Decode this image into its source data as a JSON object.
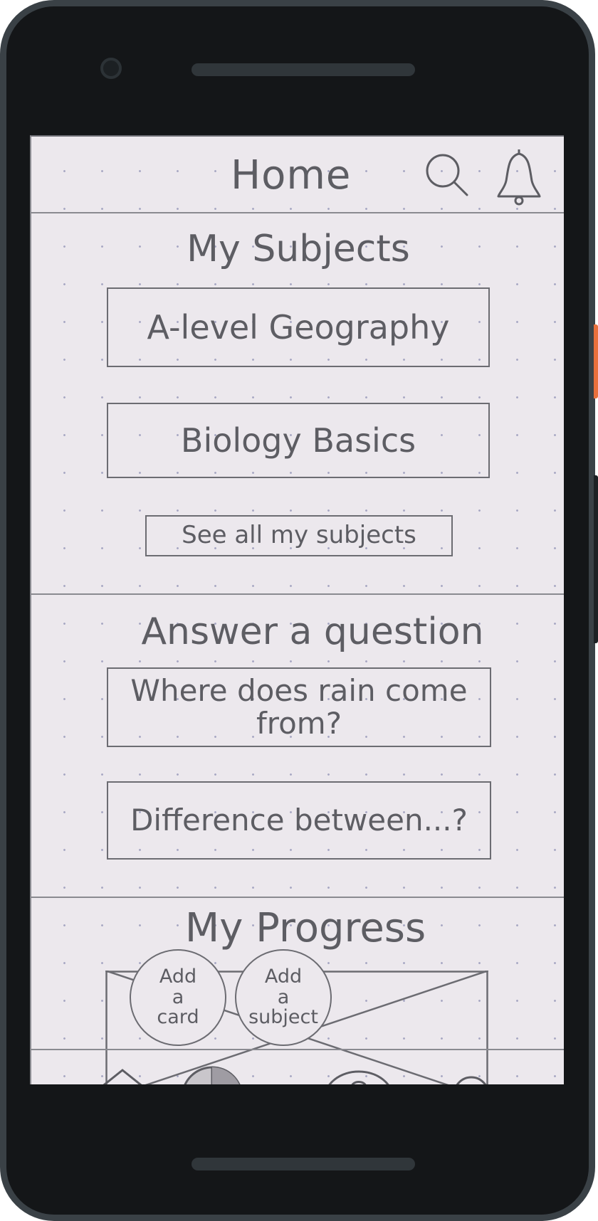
{
  "header": {
    "title": "Home",
    "search_icon": "search-icon",
    "notification_icon": "bell-icon"
  },
  "my_subjects": {
    "title": "My Subjects",
    "items": [
      {
        "label": "A-level Geography"
      },
      {
        "label": "Biology Basics"
      }
    ],
    "see_all_label": "See all my subjects"
  },
  "answer_question": {
    "title": "Answer a question",
    "items": [
      {
        "label": "Where does rain come from?"
      },
      {
        "label": "Difference between...?"
      }
    ]
  },
  "my_progress": {
    "title": "My Progress",
    "add_card_label": "Add\na\ncard",
    "add_subject_label": "Add\na\nsubject",
    "chart_placeholder": "image-placeholder"
  },
  "bottom_nav": {
    "items": [
      "home-icon",
      "pie-chart-icon",
      "question-icon",
      "profile-icon"
    ]
  },
  "colors": {
    "paper": "#ece8ed",
    "pencil": "#5d5d63",
    "frame": "#141618",
    "frame_border": "#3a4146",
    "side_button": "#e9703c"
  }
}
